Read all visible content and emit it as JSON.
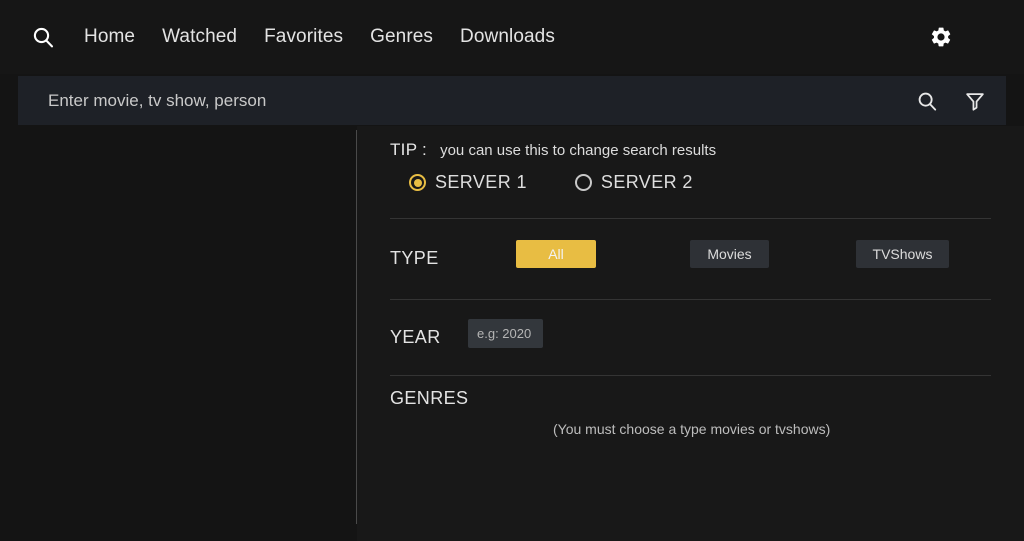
{
  "navbar": {
    "search_icon": "search-icon",
    "links": [
      {
        "label": "Home"
      },
      {
        "label": "Watched"
      },
      {
        "label": "Favorites"
      },
      {
        "label": "Genres"
      },
      {
        "label": "Downloads"
      }
    ],
    "settings_icon": "gear-icon"
  },
  "search": {
    "value": "",
    "placeholder": "Enter movie, tv show, person",
    "submit_icon": "search-icon",
    "filter_icon": "filter-funnel-icon"
  },
  "filters": {
    "tip": {
      "label": "TIP :",
      "text": "you can use this to change search results"
    },
    "servers": {
      "selected": "SERVER 1",
      "options": [
        {
          "label": "SERVER 1",
          "selected": true
        },
        {
          "label": "SERVER 2",
          "selected": false
        }
      ]
    },
    "type": {
      "label": "TYPE",
      "selected": "All",
      "options": [
        {
          "label": "All",
          "active": true
        },
        {
          "label": "Movies",
          "active": false
        },
        {
          "label": "TVShows",
          "active": false
        }
      ]
    },
    "year": {
      "label": "YEAR",
      "value": "",
      "placeholder": "e.g: 2020"
    },
    "genres": {
      "label": "GENRES",
      "hint": "(You must choose a type movies or tvshows)"
    }
  },
  "colors": {
    "accent": "#e8bd43",
    "panel_bg": "#181818",
    "page_bg": "#141414",
    "button_idle": "#2e3136",
    "searchbar_bg": "#1e2127"
  }
}
